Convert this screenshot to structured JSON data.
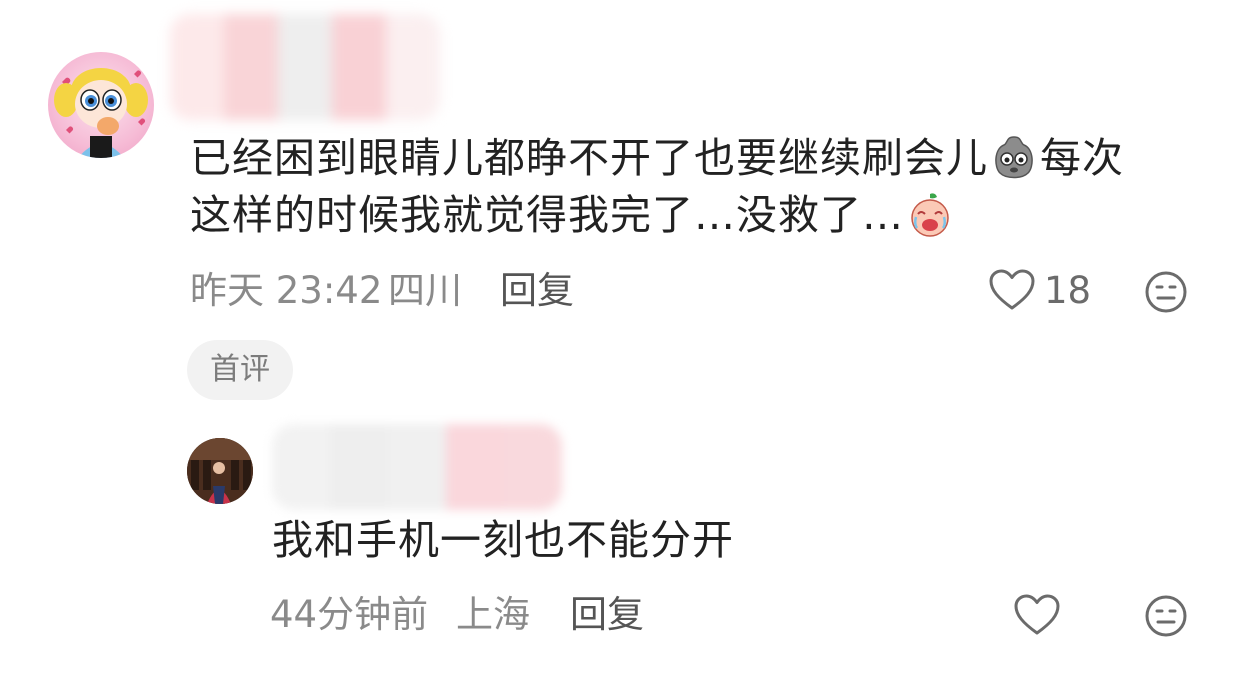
{
  "comment": {
    "avatar_icon": "cartoon-girl-avatar",
    "username_redacted": true,
    "text_line1_a": "已经困到眼睛儿都睁不开了也要继续刷会儿",
    "sticker1": "sleepy-face-sticker",
    "text_line1_b": "每次",
    "text_line2": "这样的时候我就觉得我完了…没救了…",
    "sticker2": "crying-face-sticker",
    "time": "昨天 23:42",
    "location": "四川",
    "reply_label": "回复",
    "like_icon": "heart-outline-icon",
    "like_count": "18",
    "dislike_icon": "meh-face-icon",
    "badge": "首评"
  },
  "reply": {
    "avatar_icon": "photo-avatar",
    "username_redacted": true,
    "text": "我和手机一刻也不能分开",
    "time": "44分钟前",
    "location": "上海",
    "reply_label": "回复",
    "like_icon": "heart-outline-icon",
    "dislike_icon": "meh-face-icon"
  },
  "colors": {
    "primary_text": "#222222",
    "meta_text": "#8a8a8a",
    "icon_stroke": "#6b6b6b",
    "badge_bg": "#f2f2f2"
  }
}
